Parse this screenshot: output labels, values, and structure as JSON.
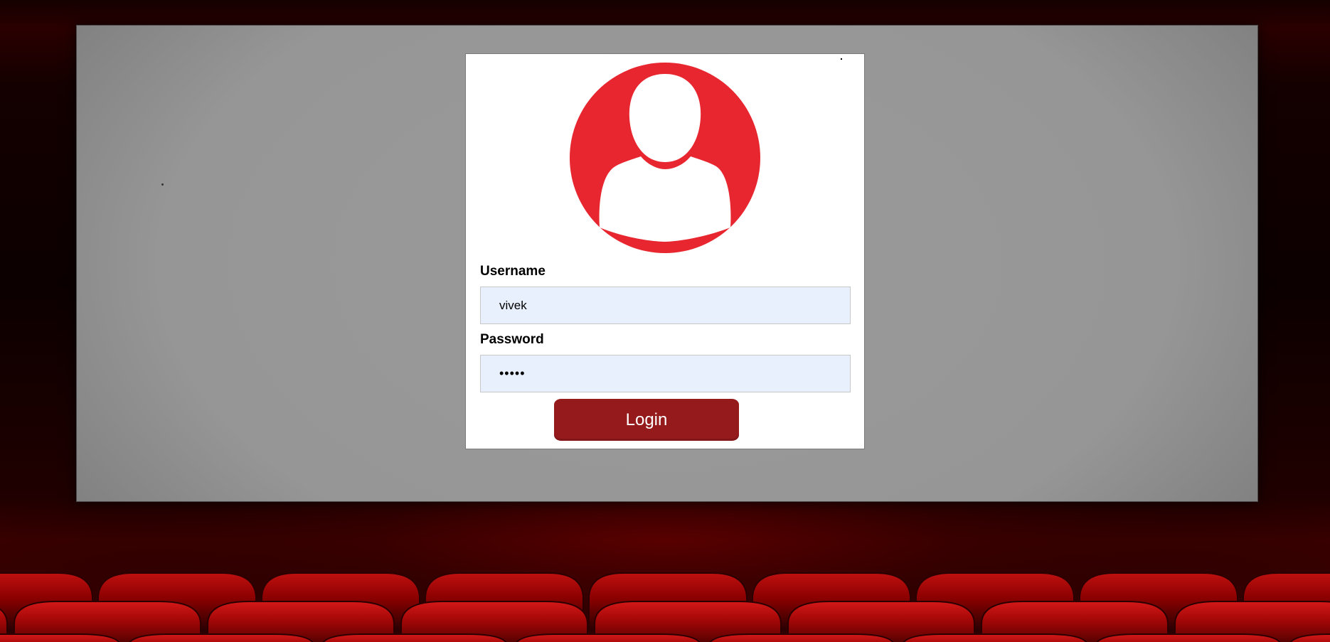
{
  "login_form": {
    "username_label": "Username",
    "username_value": "vivek",
    "password_label": "Password",
    "password_value": "vivek",
    "login_button_label": "Login"
  },
  "colors": {
    "accent": "#e8262f",
    "button": "#951a1c",
    "input_background": "#e8f0fe",
    "seat_red": "#a00000"
  },
  "icons": {
    "avatar": "user-avatar-icon"
  }
}
